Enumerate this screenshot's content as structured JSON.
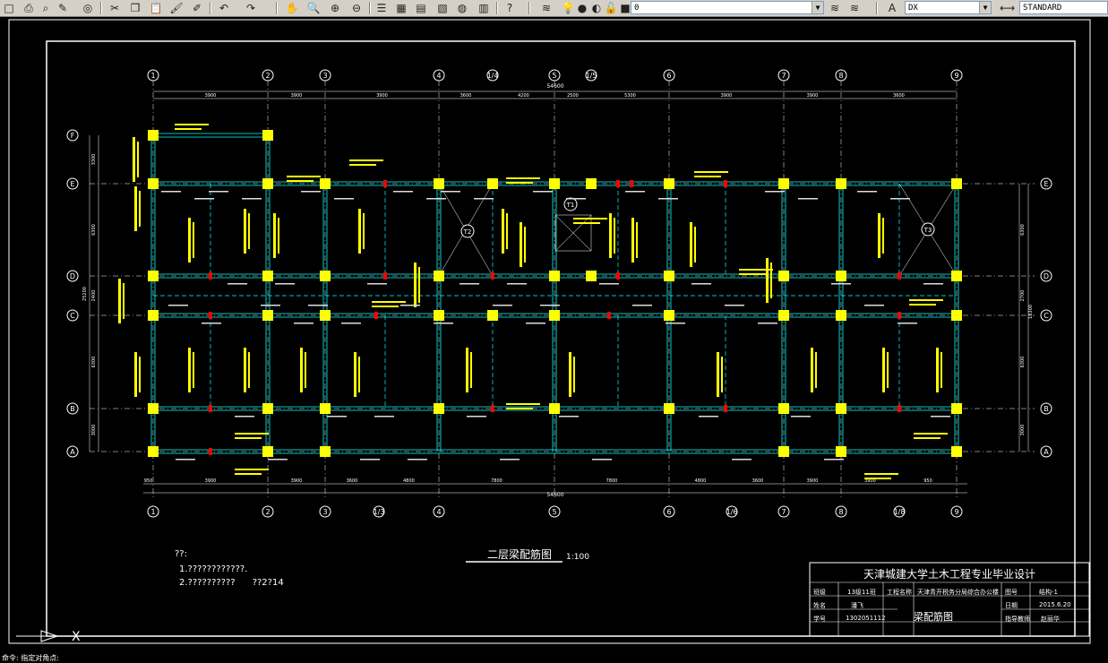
{
  "toolbar": {
    "layer_value": "0",
    "textstyle_value": "DX",
    "dimstyle_value": "STANDARD"
  },
  "drawing": {
    "total_dim": "54600",
    "top_axes": [
      "1",
      "2",
      "3",
      "4",
      "1/4",
      "5",
      "1/5",
      "6",
      "7",
      "8",
      "9"
    ],
    "top_spans": [
      "3900",
      "3900",
      "3900",
      "3600",
      "4200",
      "2500",
      "5300",
      "3900",
      "3900",
      "3600"
    ],
    "bottom_axes": [
      "1",
      "2",
      "3",
      "1/3",
      "4",
      "5",
      "6",
      "1/6",
      "7",
      "8",
      "1/8",
      "9"
    ],
    "bottom_spans": [
      "950",
      "3900",
      "3900",
      "3600",
      "4800",
      "7800",
      "7800",
      "4800",
      "3600",
      "3900",
      "3900",
      "950"
    ],
    "left_axes": [
      "F",
      "E",
      "D",
      "C",
      "B",
      "A"
    ],
    "right_axes": [
      "E",
      "D",
      "C",
      "B",
      "A"
    ],
    "left_dims": [
      "3300",
      "6300",
      "2400",
      "6300",
      "3000"
    ],
    "left_total": "25200",
    "right_dims": [
      "6300",
      "2700",
      "6300",
      "3000"
    ],
    "right_total": "18300",
    "stair_labels": [
      "T2",
      "T1",
      "T3"
    ],
    "plan_title": "二层梁配筋图",
    "plan_scale": "1:100",
    "notes_heading": "??:",
    "notes": [
      "1.????????????.",
      "2.??????????      ??2?14"
    ]
  },
  "title_block": {
    "header": "天津城建大学土木工程专业毕业设计",
    "row1": {
      "label_a": "班级",
      "value_a": "13级11班",
      "label_b": "工程名称",
      "value_b": "天津青开税务分局综合办公楼",
      "label_c": "图号",
      "value_c": "结构-1"
    },
    "row2": {
      "label_a": "姓名",
      "value_a": "潘飞",
      "label_c": "日期",
      "value_c": "2015.6.20"
    },
    "drawing_name": "梁配筋图",
    "row3": {
      "label_a": "学号",
      "value_a": "1302051112",
      "label_c": "指导教师",
      "value_c": "赵丽华"
    }
  },
  "command_line": "命令: 指定对角点:",
  "colors": {
    "background": "#000000",
    "beam": "#00ffff",
    "column": "#ffff00",
    "rebar_text": "#ffff00",
    "dim": "#ffffff",
    "section_mark": "#ff0000",
    "toolbar_bg": "#d4d0c8"
  }
}
